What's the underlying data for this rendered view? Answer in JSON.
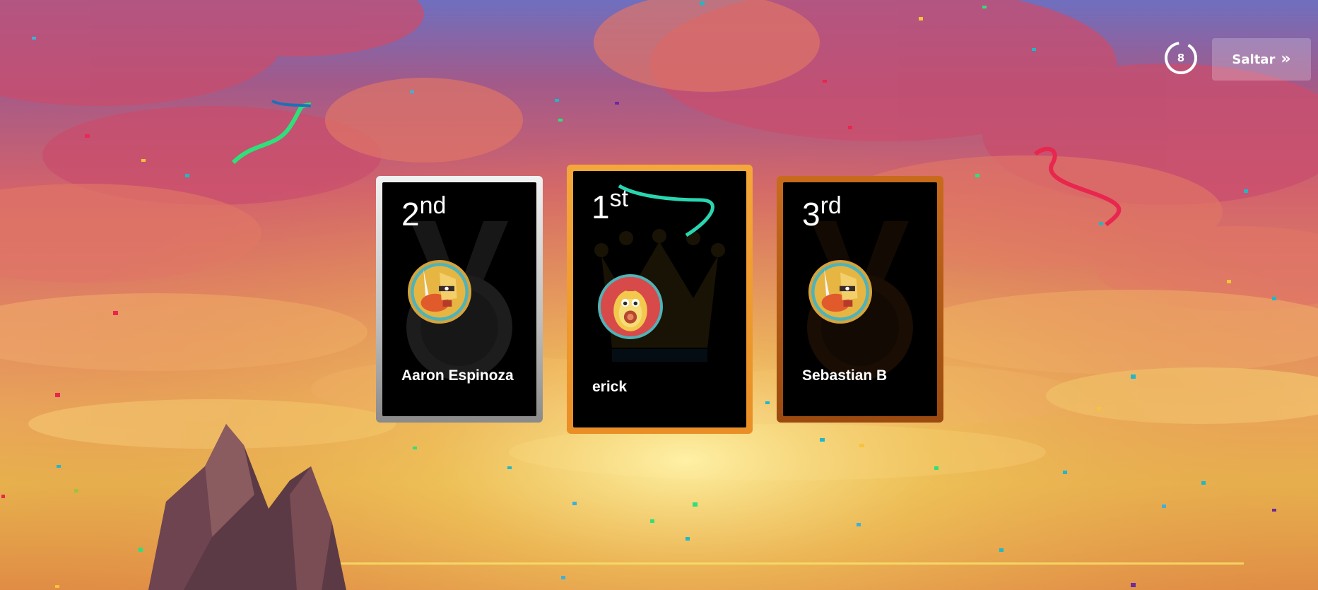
{
  "colors": {
    "sky_top": "#6f6fbf",
    "sun": "#f3e27a",
    "gold": "#f4a73a",
    "silver": "#cfcfcf",
    "bronze": "#b85f18"
  },
  "controls": {
    "countdown": "8",
    "skip_label": "Saltar",
    "skip_icon": "double-chevron-right-icon"
  },
  "podium": [
    {
      "place": "silver",
      "rank_number": "2",
      "rank_suffix": "nd",
      "player_name": "Aaron Espinoza",
      "avatar_icon": "knight-avatar-icon"
    },
    {
      "place": "gold",
      "rank_number": "1",
      "rank_suffix": "st",
      "player_name": "erick",
      "avatar_icon": "avocado-avatar-icon"
    },
    {
      "place": "bronze",
      "rank_number": "3",
      "rank_suffix": "rd",
      "player_name": "Sebastian B",
      "avatar_icon": "knight-avatar-icon"
    }
  ]
}
